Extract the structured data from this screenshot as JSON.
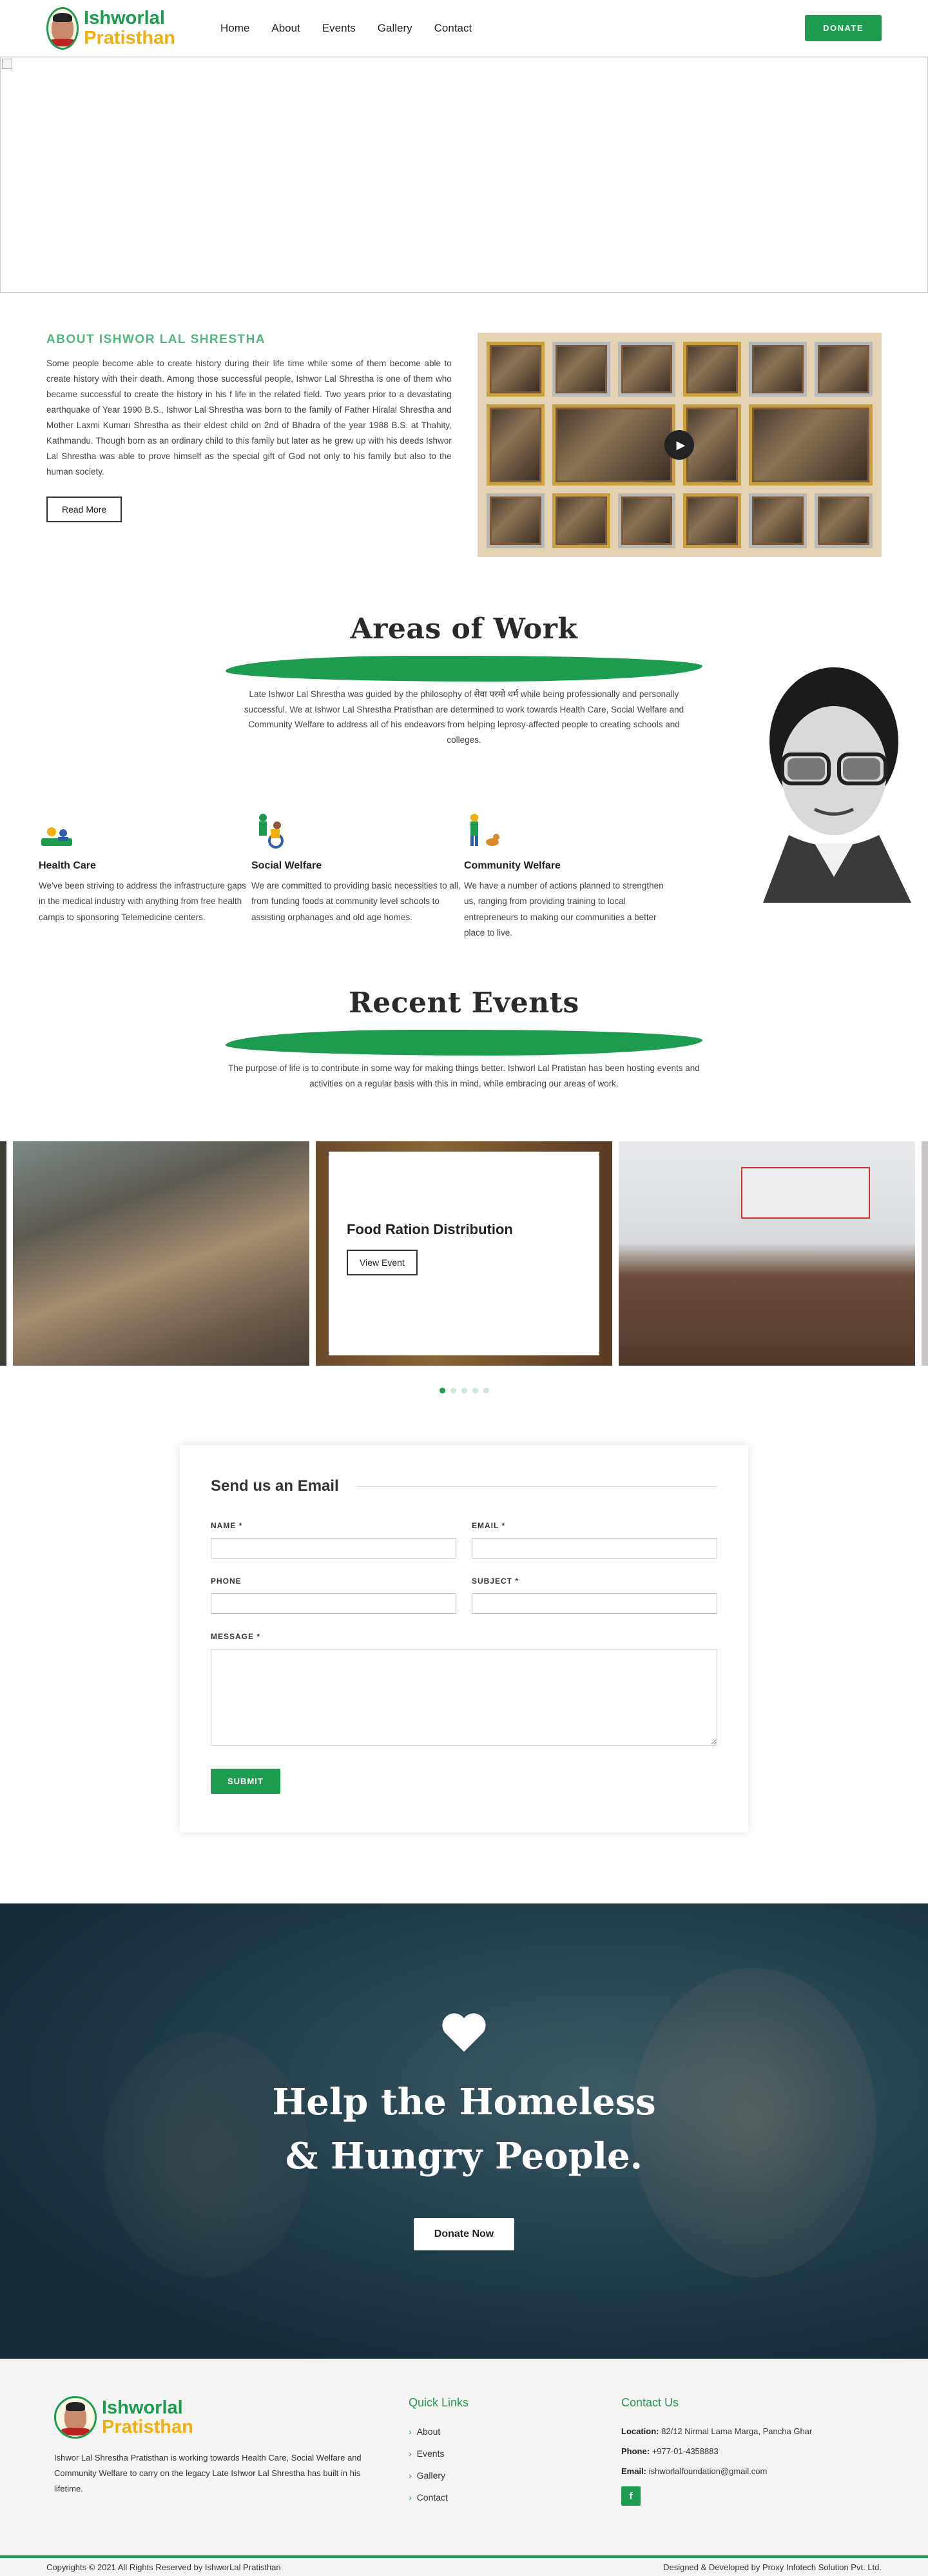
{
  "header": {
    "logo_line1": "Ishworlal",
    "logo_line2": "Pratisthan",
    "nav": [
      "Home",
      "About",
      "Events",
      "Gallery",
      "Contact"
    ],
    "donate_label": "DONATE"
  },
  "about": {
    "title": "ABOUT ISHWOR LAL SHRESTHA",
    "text": "Some people become able to create history during their life time while some of them become able to create history with their death. Among those successful people, Ishwor Lal Shrestha is one of them who became successful to create the history in his f life in the related field. Two years prior to a devastating earthquake of Year 1990 B.S., Ishwor Lal Shrestha was born to the family of Father Hiralal Shrestha and Mother Laxmi Kumari Shrestha as their eldest child on 2nd of Bhadra of the year 1988 B.S. at Thahity, Kathmandu. Though born as an ordinary child to this family but later as he grew up with his deeds Ishwor Lal Shrestha was able to prove himself as the special gift of God not only to his family but also to the human society.",
    "read_more": "Read More"
  },
  "areas": {
    "title": "Areas of Work",
    "subtitle": "Late Ishwor Lal Shrestha was guided by the philosophy of सेवा परमो धर्म while being professionally and personally successful. We at Ishwor Lal Shrestha Pratisthan are determined to work towards Health Care, Social Welfare and Community Welfare to address all of his endeavors from helping leprosy-affected people to creating schools and colleges.",
    "items": [
      {
        "title": "Health Care",
        "text": "We've been striving to address the infrastructure gaps in the medical industry with anything from free health camps to sponsoring Telemedicine centers.",
        "icon": "health-care-icon"
      },
      {
        "title": "Social Welfare",
        "text": "We are committed to providing basic necessities to all, from funding foods at community level schools to assisting orphanages and old age homes.",
        "icon": "social-welfare-icon"
      },
      {
        "title": "Community Welfare",
        "text": "We have a number of actions planned to strengthen us, ranging from providing training to local entrepreneurs to making our communities a better place to live.",
        "icon": "community-welfare-icon"
      }
    ]
  },
  "events": {
    "title": "Recent Events",
    "subtitle": "The purpose of life is to contribute in some way for making things better. Ishworl Lal Pratistan has been hosting events and activities on a regular basis with this in mind, while embracing our areas of work.",
    "card_title": "Food Ration Distribution",
    "card_button": "View Event",
    "dots": 5,
    "active_dot": 0
  },
  "form": {
    "title": "Send us an Email",
    "name_label": "NAME *",
    "email_label": "EMAIL *",
    "phone_label": "PHONE",
    "subject_label": "SUBJECT *",
    "message_label": "MESSAGE *",
    "submit_label": "SUBMIT"
  },
  "help": {
    "title": "Help the Homeless & Hungry People.",
    "button": "Donate Now"
  },
  "footer": {
    "about": "Ishwor Lal Shrestha Pratisthan is working towards Health Care, Social Welfare and Community Welfare to carry on the legacy Late Ishwor Lal Shrestha has built in his lifetime.",
    "quick_links_title": "Quick Links",
    "quick_links": [
      "About",
      "Events",
      "Gallery",
      "Contact"
    ],
    "contact_title": "Contact Us",
    "location_label": "Location:",
    "location": "82/12 Nirmal Lama Marga, Pancha Ghar",
    "phone_label": "Phone:",
    "phone": "+977-01-4358883",
    "email_label": "Email:",
    "email": "ishworlalfoundation@gmail.com",
    "facebook": "f"
  },
  "copyright": {
    "left": "Copyrights © 2021 All Rights Reserved by IshworLal Pratisthan",
    "right": "Designed & Developed by Proxy Infotech Solution Pvt. Ltd."
  },
  "colors": {
    "brand_green": "#1d9b4e",
    "brand_yellow": "#f2b010",
    "dark_banner": "#1c3a47"
  }
}
